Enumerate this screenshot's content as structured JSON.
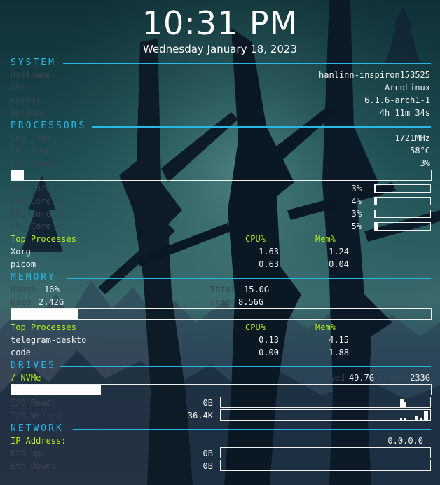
{
  "clock": {
    "time": "10:31 PM",
    "date": "Wednesday January 18, 2023"
  },
  "system": {
    "header": "SYSTEM",
    "rows": [
      {
        "label": "Hostname:",
        "value": "hanlinn-inspiron153525"
      },
      {
        "label": "OS:",
        "value": "ArcoLinux"
      },
      {
        "label": "Kernel:",
        "value": "6.1.6-arch1-1"
      },
      {
        "label": "Uptime:",
        "value": "4h 11m 34s"
      }
    ]
  },
  "processors": {
    "header": "PROCESSORS",
    "rows": [
      {
        "label": "CPU Freq:",
        "value": "1721MHz"
      },
      {
        "label": "CPU Temp:",
        "value": "58°C"
      },
      {
        "label": "CPU Usage:",
        "value": "3%"
      }
    ],
    "usage_percent": 3,
    "cores": [
      {
        "label": "CPU Core 1:",
        "value": "3%",
        "percent": 3
      },
      {
        "label": "CPU Core 2:",
        "value": "4%",
        "percent": 4
      },
      {
        "label": "CPU Core 3:",
        "value": "3%",
        "percent": 3
      },
      {
        "label": "CPU Core 4:",
        "value": "5%",
        "percent": 5
      }
    ],
    "top": {
      "title": "Top Processes",
      "col_cpu": "CPU%",
      "col_mem": "Mem%",
      "procs": [
        {
          "name": "Xorg",
          "cpu": "1.63",
          "mem": "1.24"
        },
        {
          "name": "picom",
          "cpu": "0.63",
          "mem": "0.04"
        }
      ]
    }
  },
  "memory": {
    "header": "MEMORY",
    "usage_label": "Usage",
    "usage_value": "16%",
    "total_label": "Total",
    "total_value": "15.0G",
    "used_label": "Used",
    "used_value": "2.42G",
    "free_label": "Free",
    "free_value": "8.56G",
    "usage_percent": 16,
    "top": {
      "title": "Top Processes",
      "col_cpu": "CPU%",
      "col_mem": "Mem%",
      "procs": [
        {
          "name": "telegram-deskto",
          "cpu": "0.13",
          "mem": "4.15"
        },
        {
          "name": "code",
          "cpu": "0.00",
          "mem": "1.88"
        }
      ]
    }
  },
  "drives": {
    "header": "DRIVES",
    "name": "/ NVMe",
    "used_label": "Used",
    "used_value": "49.7G",
    "total_label": "Total",
    "total_value": "233G",
    "used_fraction": 0.213,
    "io_read_label": "I/O Read:",
    "io_read_value": "0B",
    "io_write_label": "I/O Write:",
    "io_write_value": "36.4K"
  },
  "network": {
    "header": "NETWORK",
    "ip_label": "IP Address:",
    "ip_value": "0.0.0.0",
    "up_label": "Eth Up:",
    "up_value": "0B",
    "down_label": "Eth Down:",
    "down_value": "0B"
  },
  "colors": {
    "accent": "#29b8e5",
    "label": "#3b4652",
    "highlight": "#b5f01a",
    "text": "#f2f2f2"
  }
}
